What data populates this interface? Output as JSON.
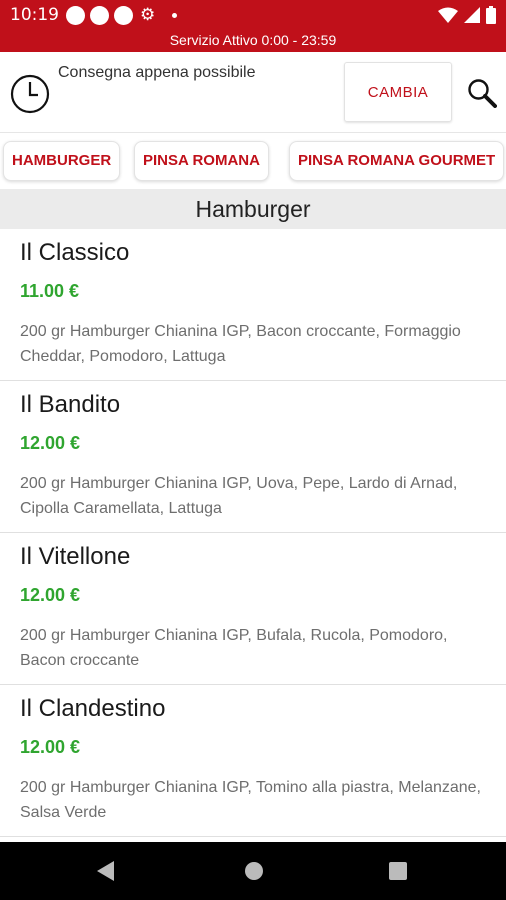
{
  "status_bar": {
    "time": "10:19",
    "service_text": "Servizio Attivo  0:00 - 23:59",
    "icons": [
      "notification-dot-icon",
      "notification-dot-icon",
      "notification-dot-icon",
      "gear-icon",
      "small-dot-icon",
      "wifi-icon",
      "signal-icon",
      "battery-icon"
    ],
    "color": "#c0101a"
  },
  "header": {
    "delivery_text": "Consegna appena possibile",
    "change_label": "CAMBIA",
    "icons": [
      "clock-icon",
      "search-icon"
    ]
  },
  "tabs": [
    {
      "label": "HAMBURGER"
    },
    {
      "label": "PINSA ROMANA"
    },
    {
      "label": "PINSA ROMANA GOURMET"
    }
  ],
  "section": {
    "title": "Hamburger"
  },
  "items": [
    {
      "name": "Il Classico",
      "price": "11.00 €",
      "description": "200 gr Hamburger Chianina IGP, Bacon croccante, Formaggio Cheddar, Pomodoro, Lattuga"
    },
    {
      "name": "Il Bandito",
      "price": "12.00 €",
      "description": "200 gr Hamburger Chianina IGP, Uova, Pepe, Lardo di Arnad, Cipolla Caramellata, Lattuga"
    },
    {
      "name": "Il Vitellone",
      "price": "12.00 €",
      "description": "200 gr Hamburger Chianina IGP, Bufala, Rucola, Pomodoro, Bacon croccante"
    },
    {
      "name": "Il Clandestino",
      "price": "12.00 €",
      "description": "200 gr Hamburger Chianina IGP, Tomino alla piastra, Melanzane, Salsa Verde"
    }
  ],
  "colors": {
    "accent": "#c0101a",
    "price": "#2fa52f"
  },
  "nav_bar": {
    "icons": [
      "back-icon",
      "home-icon",
      "recent-apps-icon"
    ]
  }
}
